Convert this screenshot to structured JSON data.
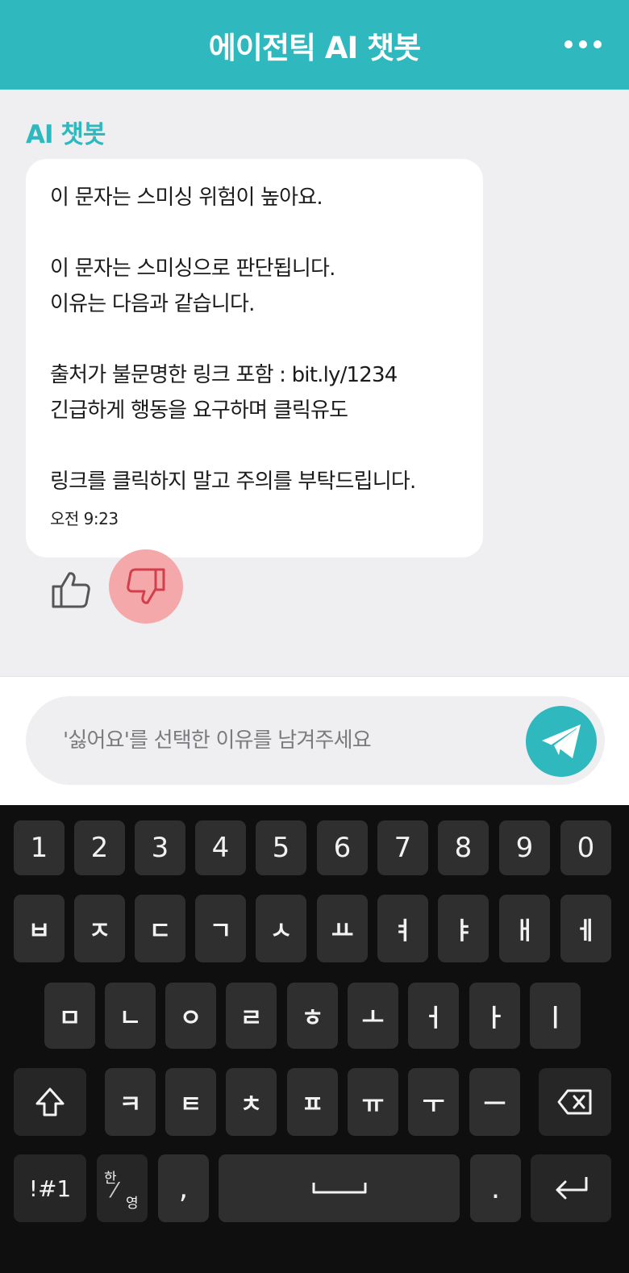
{
  "header": {
    "title": "에이전틱 AI 챗봇"
  },
  "chat": {
    "sender": "AI 챗봇",
    "message": {
      "lines": [
        "이 문자는 스미싱 위험이 높아요.",
        "",
        "이 문자는 스미싱으로 판단됩니다.",
        "이유는 다음과 같습니다.",
        "",
        "출처가 불문명한 링크 포함 : bit.ly/1234",
        "긴급하게 행동을 요구하며 클릭유도",
        "",
        "링크를 클릭하지 말고 주의를 부탁드립니다."
      ],
      "time": "오전 9:23"
    },
    "feedback": {
      "disliked": true
    }
  },
  "input": {
    "placeholder": "'싫어요'를 선택한 이유를 남겨주세요"
  },
  "keyboard": {
    "number_row": [
      "1",
      "2",
      "3",
      "4",
      "5",
      "6",
      "7",
      "8",
      "9",
      "0"
    ],
    "row1": [
      "ㅂ",
      "ㅈ",
      "ㄷ",
      "ㄱ",
      "ㅅ",
      "ㅛ",
      "ㅕ",
      "ㅑ",
      "ㅐ",
      "ㅔ"
    ],
    "row2": [
      "ㅁ",
      "ㄴ",
      "ㅇ",
      "ㄹ",
      "ㅎ",
      "ㅗ",
      "ㅓ",
      "ㅏ",
      "ㅣ"
    ],
    "row3": [
      "ㅋ",
      "ㅌ",
      "ㅊ",
      "ㅍ",
      "ㅠ",
      "ㅜ",
      "ㅡ"
    ],
    "symbols_label": "!#1",
    "lang_top": "한",
    "lang_bottom": "영",
    "comma": ",",
    "period": "."
  },
  "colors": {
    "accent": "#2fb9bf",
    "dislike_highlight": "#f5a8aa",
    "keyboard_bg": "#0f0f10",
    "key_bg": "#2f2f30"
  }
}
